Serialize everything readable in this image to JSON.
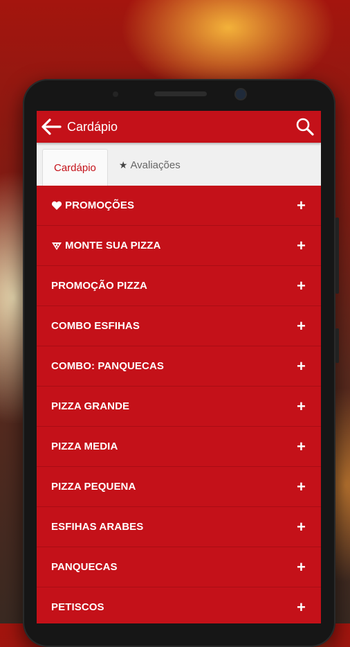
{
  "appbar": {
    "title": "Cardápio"
  },
  "tabs": [
    {
      "label": "Cardápio"
    },
    {
      "label": "Avaliações"
    }
  ],
  "menu": [
    {
      "label": "PROMOÇÕES",
      "icon": "heart-icon"
    },
    {
      "label": "MONTE SUA PIZZA",
      "icon": "pizza-slice-icon"
    },
    {
      "label": "PROMOÇÃO PIZZA"
    },
    {
      "label": "COMBO ESFIHAS"
    },
    {
      "label": "COMBO: PANQUECAS"
    },
    {
      "label": "PIZZA GRANDE"
    },
    {
      "label": "PIZZA MEDIA"
    },
    {
      "label": "PIZZA PEQUENA"
    },
    {
      "label": "ESFIHAS ARABES"
    },
    {
      "label": "PANQUECAS"
    },
    {
      "label": "PETISCOS"
    }
  ],
  "expand_symbol": "+",
  "colors": {
    "primary": "#c41119",
    "tab_bg": "#f0f0f0"
  }
}
